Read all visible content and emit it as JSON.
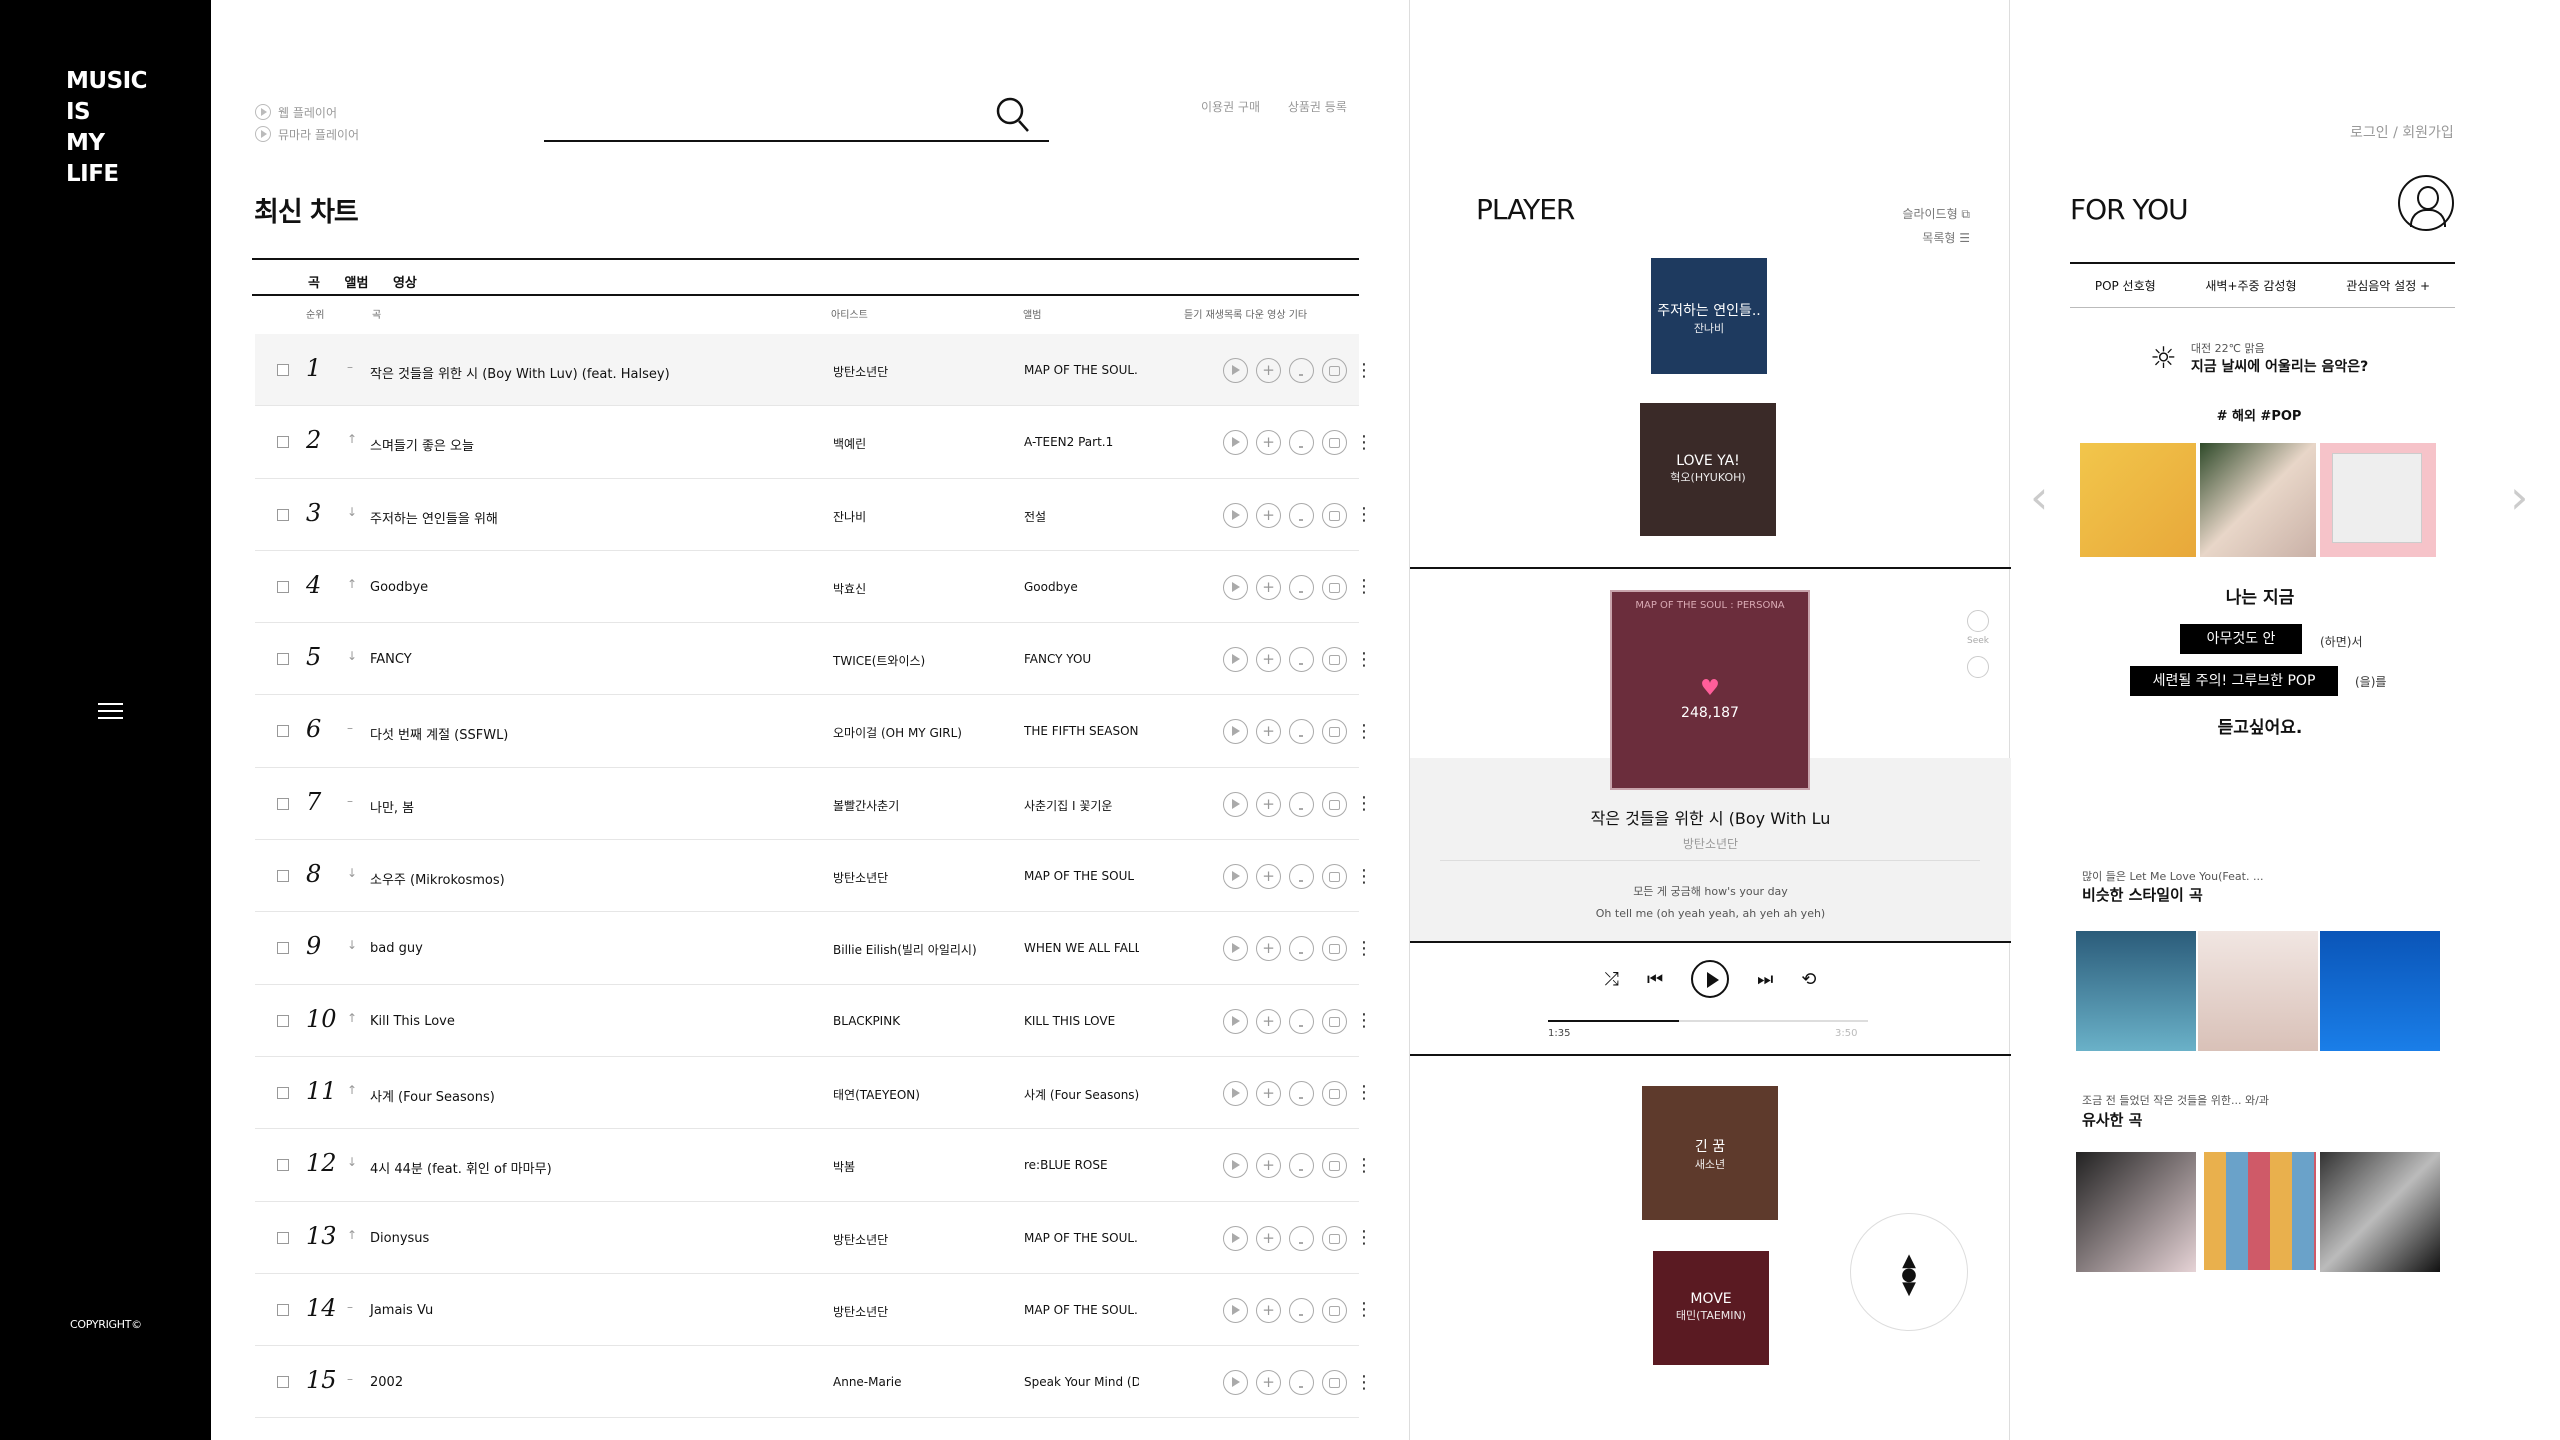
{
  "sidebar": {
    "logo": [
      "MUSIC",
      "IS",
      "MY",
      "LIFE"
    ],
    "copyright": "COPYRIGHT©"
  },
  "header": {
    "player_links": [
      "웹 플레이어",
      "뮤마라 플레이어"
    ],
    "search_placeholder": "",
    "top_links": [
      "이용권 구매",
      "상품권 등록"
    ]
  },
  "chart": {
    "title": "최신 차트",
    "tabs": [
      "곡",
      "앨범",
      "영상"
    ],
    "columns": {
      "rank": "순위",
      "song": "곡",
      "artist": "아티스트",
      "album": "앨범",
      "actions": "듣기 재생목록 다운 영상 기타"
    },
    "rows": [
      {
        "rank": "1",
        "trend": "–",
        "song": "작은 것들을 위한 시 (Boy With Luv) (feat. Halsey)",
        "artist": "방탄소년단",
        "album": "MAP OF THE SOUL..."
      },
      {
        "rank": "2",
        "trend": "↑",
        "song": "스며들기 좋은 오늘",
        "artist": "백예린",
        "album": "A-TEEN2 Part.1"
      },
      {
        "rank": "3",
        "trend": "↓",
        "song": "주저하는 연인들을 위해",
        "artist": "잔나비",
        "album": "전설"
      },
      {
        "rank": "4",
        "trend": "↑",
        "song": "Goodbye",
        "artist": "박효신",
        "album": "Goodbye"
      },
      {
        "rank": "5",
        "trend": "↓",
        "song": "FANCY",
        "artist": "TWICE(트와이스)",
        "album": "FANCY YOU"
      },
      {
        "rank": "6",
        "trend": "–",
        "song": "다섯 번째 계절 (SSFWL)",
        "artist": "오마이걸 (OH MY GIRL)",
        "album": "THE FIFTH SEASON"
      },
      {
        "rank": "7",
        "trend": "–",
        "song": "나만, 봄",
        "artist": "볼빨간사춘기",
        "album": "사춘기집 I 꽃기운"
      },
      {
        "rank": "8",
        "trend": "↓",
        "song": "소우주 (Mikrokosmos)",
        "artist": "방탄소년단",
        "album": "MAP OF THE SOUL ..."
      },
      {
        "rank": "9",
        "trend": "↓",
        "song": "bad guy",
        "artist": "Billie Eilish(빌리 아일리시)",
        "album": "WHEN WE ALL FALL..."
      },
      {
        "rank": "10",
        "trend": "↑",
        "song": "Kill This Love",
        "artist": "BLACKPINK",
        "album": "KILL THIS LOVE"
      },
      {
        "rank": "11",
        "trend": "↑",
        "song": "사계 (Four Seasons)",
        "artist": "태연(TAEYEON)",
        "album": "사계 (Four Seasons)"
      },
      {
        "rank": "12",
        "trend": "↓",
        "song": "4시 44분 (feat. 휘인 of 마마무)",
        "artist": "박봄",
        "album": "re:BLUE ROSE"
      },
      {
        "rank": "13",
        "trend": "↑",
        "song": "Dionysus",
        "artist": "방탄소년단",
        "album": "MAP OF THE SOUL..."
      },
      {
        "rank": "14",
        "trend": "–",
        "song": "Jamais Vu",
        "artist": "방탄소년단",
        "album": "MAP OF THE SOUL..."
      },
      {
        "rank": "15",
        "trend": "–",
        "song": "2002",
        "artist": "Anne-Marie",
        "album": "Speak Your Mind (D..."
      }
    ]
  },
  "player": {
    "title": "PLAYER",
    "view_options": [
      "슬라이드형",
      "목록형"
    ],
    "queue_above": [
      {
        "title": "주저하는 연인들..",
        "artist": "잔나비",
        "color": "#1e3a5f"
      },
      {
        "title": "LOVE YA!",
        "artist": "혁오(HYUKOH)",
        "color": "#3a2a28"
      }
    ],
    "now_playing": {
      "cover_band": "MAP OF THE SOUL : PERSONA",
      "likes": "248,187",
      "title": "작은 것들을 위한 시 (Boy With Lu",
      "artist": "방탄소년단",
      "lyric1": "모든 게 궁금해 how's your day",
      "lyric2": "Oh tell me (oh yeah yeah, ah yeh ah yeh)",
      "time_current": "1:35",
      "time_total": "3:50",
      "progress": 0.41,
      "side_label": "Seek"
    },
    "queue_below": [
      {
        "title": "긴 꿈",
        "artist": "새소년",
        "color": "#5e3a2c"
      },
      {
        "title": "MOVE",
        "artist": "태민(TAEMIN)",
        "color": "#5a1a22"
      }
    ]
  },
  "foryou": {
    "login": "로그인 / 회원가입",
    "title": "FOR YOU",
    "tabs": [
      "POP 선호형",
      "새벽+주중 감성형",
      "관심음악 설정 +"
    ],
    "weather_line": "대전 22℃ 맑음",
    "weather_question": "지금 날씨에 어울리는 음악은?",
    "hashtag": "# 해외 #POP",
    "q_start": "나는 지금",
    "pill1": "아무것도 안",
    "pill1_suffix": "(하면)서",
    "pill2": "세련될 주의! 그루브한 POP",
    "pill2_suffix": "(을)를",
    "q_end": "듣고싶어요.",
    "similar_style_sub": "많이 들은 Let Me Love You(Feat. ...",
    "similar_style_title": "비슷한 스타일이 곡",
    "similar_song_sub": "조금 전 들었던 작은 것들을 위한... 와/과",
    "similar_song_title": "유사한 곡"
  }
}
